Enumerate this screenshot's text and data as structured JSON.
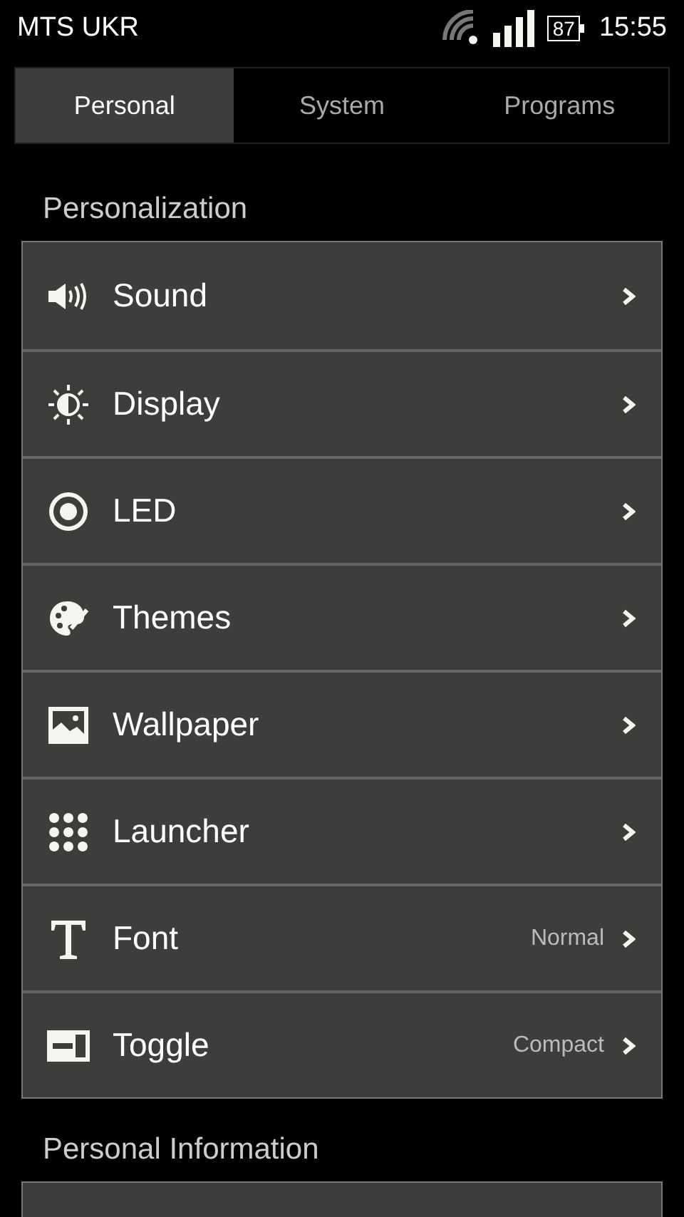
{
  "status_bar": {
    "carrier": "MTS UKR",
    "battery": "87",
    "time": "15:55"
  },
  "tabs": [
    {
      "label": "Personal",
      "selected": true
    },
    {
      "label": "System",
      "selected": false
    },
    {
      "label": "Programs",
      "selected": false
    }
  ],
  "sections": [
    {
      "title": "Personalization",
      "items": [
        {
          "label": "Sound"
        },
        {
          "label": "Display"
        },
        {
          "label": "LED"
        },
        {
          "label": "Themes"
        },
        {
          "label": "Wallpaper"
        },
        {
          "label": "Launcher"
        },
        {
          "label": "Font",
          "value": "Normal"
        },
        {
          "label": "Toggle",
          "value": "Compact"
        }
      ]
    },
    {
      "title": "Personal Information"
    }
  ]
}
